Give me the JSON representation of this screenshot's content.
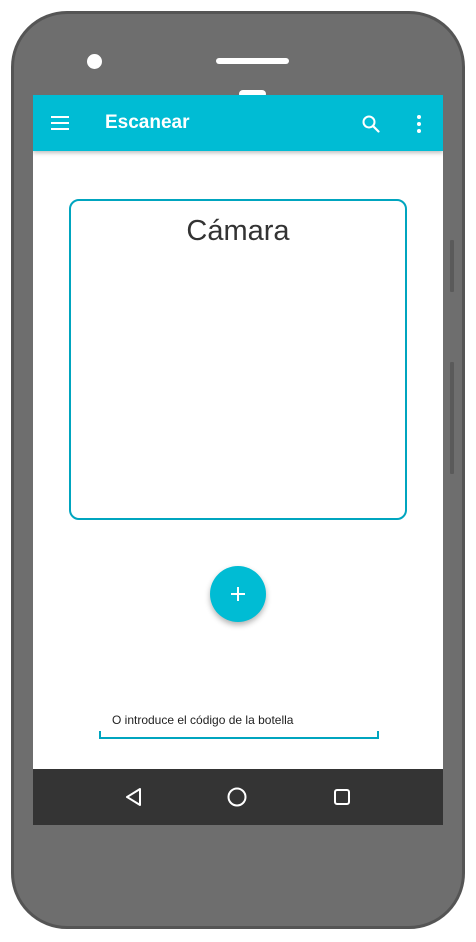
{
  "appbar": {
    "title": "Escanear",
    "background_color": "#00bcd4",
    "icons": [
      "menu-icon",
      "search-icon",
      "more-vert-icon"
    ]
  },
  "camera": {
    "label": "Cámara",
    "border_color": "#00a5bf"
  },
  "fab": {
    "icon": "plus-icon",
    "color": "#00bcd4"
  },
  "code_input": {
    "placeholder": "O introduce el código de la botella",
    "underline_color": "#00a5bf"
  },
  "navbar": {
    "background_color": "#343434",
    "icons": [
      "back-icon",
      "home-icon",
      "recents-icon"
    ]
  },
  "device": {
    "body_color": "#6e6e6e"
  }
}
